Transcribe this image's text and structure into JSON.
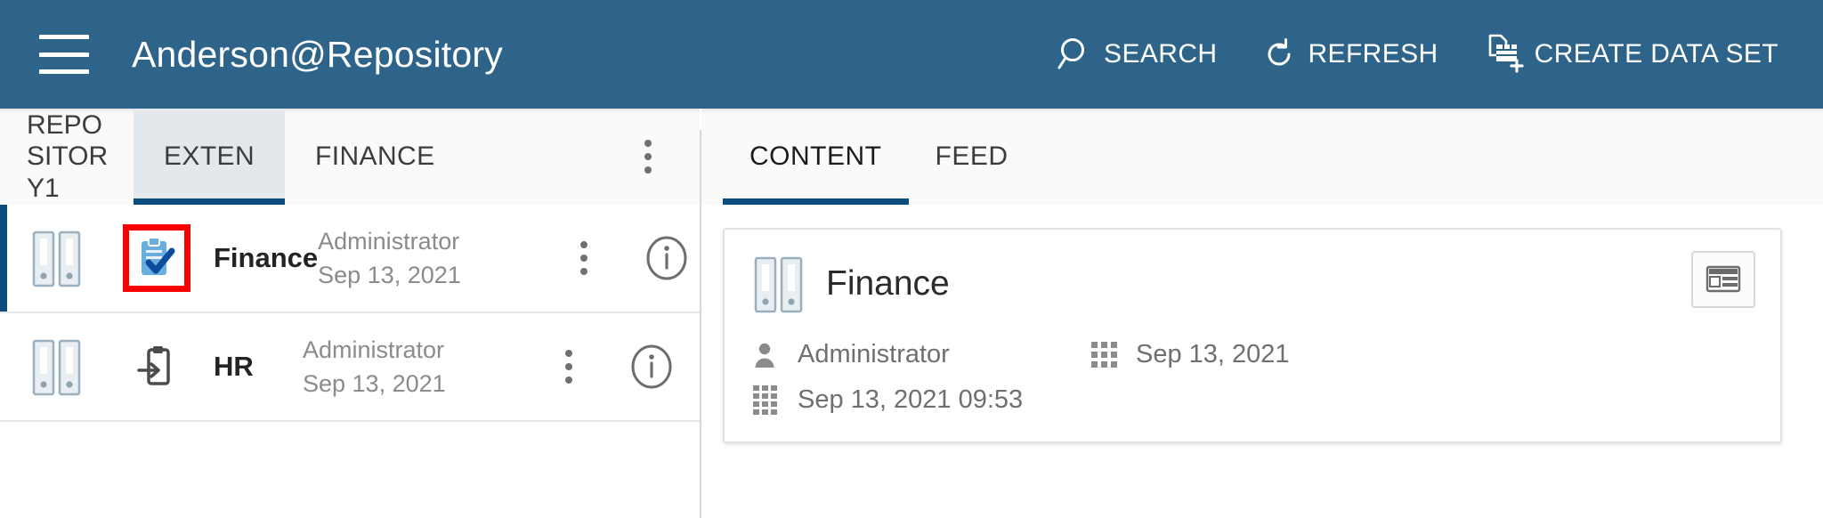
{
  "header": {
    "menu_icon": "hamburger-menu-icon",
    "title": "Anderson@Repository",
    "actions": [
      {
        "label": "SEARCH",
        "icon": "search-icon"
      },
      {
        "label": "REFRESH",
        "icon": "refresh-icon"
      },
      {
        "label": "CREATE DATA SET",
        "icon": "create-data-set-icon"
      }
    ]
  },
  "left_panel": {
    "breadcrumb": "REPOSITORY1",
    "tabs": [
      {
        "label": "EXTEN",
        "active": true
      },
      {
        "label": "FINANCE",
        "active": false
      }
    ],
    "overflow_icon": "kebab-menu-icon",
    "rows": [
      {
        "binder_icon": "binder-icon",
        "type_icon": "clipboard-check-icon",
        "type_icon_highlighted": true,
        "name": "Finance",
        "modified_by": "Administrator",
        "modified_date": "Sep 13, 2021",
        "kebab_icon": "kebab-menu-icon",
        "info_icon": "info-circle-icon",
        "selected": true
      },
      {
        "binder_icon": "binder-icon",
        "type_icon": "clipboard-import-icon",
        "type_icon_highlighted": false,
        "name": "HR",
        "modified_by": "Administrator",
        "modified_date": "Sep 13, 2021",
        "kebab_icon": "kebab-menu-icon",
        "info_icon": "info-circle-icon",
        "selected": false
      }
    ]
  },
  "right_panel": {
    "tabs": [
      {
        "label": "CONTENT",
        "active": true
      },
      {
        "label": "FEED",
        "active": false
      }
    ],
    "card": {
      "binder_icon": "binder-icon",
      "title": "Finance",
      "action_icon": "table-properties-icon",
      "meta": [
        {
          "icon": "person-icon",
          "text": "Administrator"
        },
        {
          "icon": "calendar-icon",
          "text": "Sep 13, 2021"
        },
        {
          "icon": "calendar-icon",
          "text": "Sep 13, 2021 09:53"
        }
      ]
    }
  },
  "colors": {
    "header_bg": "#2e6489",
    "accent": "#0b4c7c",
    "active_tab_bg": "#e3e8ec",
    "highlight_box": "#fb0000",
    "icon_blue_light": "#6aaee0",
    "icon_blue_dark": "#0b4c9c",
    "muted_text": "#8b8b8b"
  }
}
